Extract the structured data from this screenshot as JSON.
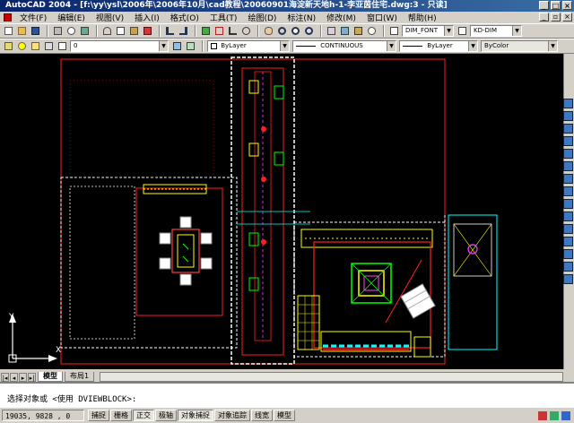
{
  "window": {
    "title": "AutoCAD 2004 - [f:\\yy\\ysl\\2006年\\2006年10月\\cad教程\\20060901海淀新天地h-1-李亚茵住宅.dwg:3 - 只读]"
  },
  "menu": [
    {
      "label": "文件(F)"
    },
    {
      "label": "编辑(E)"
    },
    {
      "label": "视图(V)"
    },
    {
      "label": "插入(I)"
    },
    {
      "label": "格式(O)"
    },
    {
      "label": "工具(T)"
    },
    {
      "label": "绘图(D)"
    },
    {
      "label": "标注(N)"
    },
    {
      "label": "修改(M)"
    },
    {
      "label": "窗口(W)"
    },
    {
      "label": "帮助(H)"
    }
  ],
  "toolbar1": {
    "text_style": "DIM_FONT",
    "dim_style": "KD-DIM"
  },
  "toolbar2": {
    "layer": "0",
    "color": "ByLayer",
    "linetype": "CONTINUOUS",
    "lineweight": "ByLayer",
    "plotstyle": "ByColor"
  },
  "tabs": {
    "model": "模型",
    "layout1": "布局1"
  },
  "command": {
    "line1": "",
    "line2": "选择对象或 <使用 DVIEWBLOCK>:"
  },
  "status": {
    "coords": "19035, 9828 , 0",
    "buttons": [
      "捕捉",
      "栅格",
      "正交",
      "极轴",
      "对象捕捉",
      "对象追踪",
      "线宽",
      "模型"
    ]
  },
  "ucs": {
    "x_label": "X",
    "y_label": "Y"
  },
  "colors": {
    "canvas": "#000000",
    "wall_white": "#ffffff",
    "red": "#ff2020",
    "yellow": "#ffff00",
    "cyan": "#00ffff",
    "magenta": "#ff40ff",
    "green": "#00ff00"
  }
}
